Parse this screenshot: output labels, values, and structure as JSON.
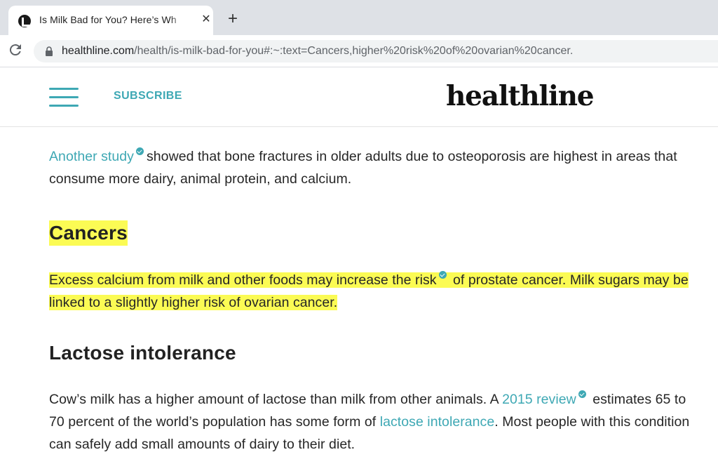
{
  "browser": {
    "tab_title": "Is Milk Bad for You? Here’s Wh",
    "tab_close": "✕",
    "new_tab": "+",
    "url_host": "healthline.com",
    "url_path": "/health/is-milk-bad-for-you#:~:text=Cancers,higher%20risk%20of%20ovarian%20cancer."
  },
  "header": {
    "subscribe_label": "SUBSCRIBE",
    "logo_text": "healthline"
  },
  "article": {
    "para1": {
      "link_text": "Another study",
      "text": "showed that bone fractures in older adults due to osteoporosis are highest in areas that consume more dairy, animal protein, and calcium."
    },
    "heading_cancers": "Cancers",
    "para2": {
      "text_before": "Excess calcium from milk and other foods may increase the risk",
      "text_after": "of prostate cancer. Milk sugars may be linked to a slightly higher risk of ovarian cancer."
    },
    "heading_lactose": "Lactose intolerance",
    "para3": {
      "text_before": "Cow’s milk has a higher amount of lactose than milk from other animals. A",
      "link1_text": "2015 review",
      "text_middle": "estimates 65 to 70 percent of the world’s population has some form of",
      "link2_text": "lactose intolerance",
      "text_after": ". Most people with this condition can safely add small amounts of dairy to their diet."
    }
  },
  "colors": {
    "accent": "#3ea8b4",
    "highlight": "#fbfb54",
    "text": "#262626"
  },
  "icons": {
    "favicon": "healthline-favicon-icon",
    "reload": "reload-icon",
    "lock": "lock-icon",
    "menu": "hamburger-menu-icon",
    "verified": "verified-check-icon"
  }
}
